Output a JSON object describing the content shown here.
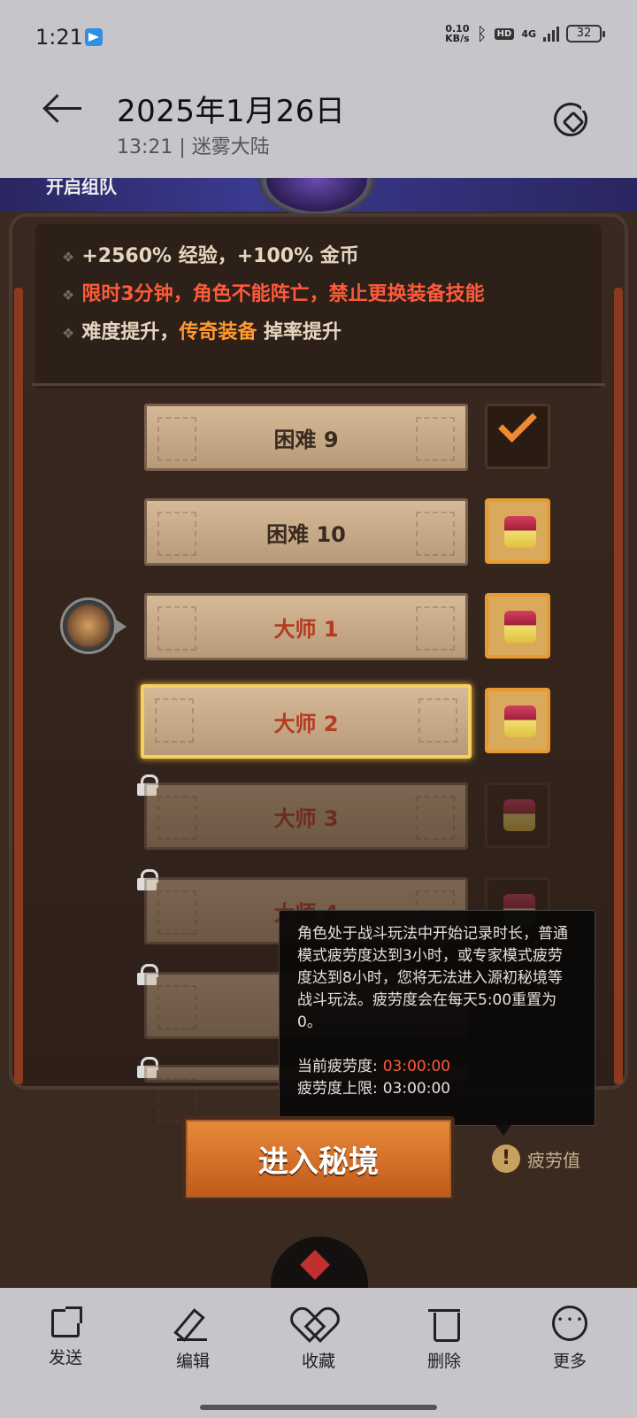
{
  "status_bar": {
    "time": "1:21",
    "speed_value": "0.10",
    "speed_unit": "KB/s",
    "hd": "HD",
    "network": "4G",
    "battery": "32"
  },
  "header": {
    "title": "2025年1月26日",
    "subtitle": "13:21 | 迷雾大陆"
  },
  "game": {
    "team_title": "开启组队",
    "info_lines": [
      {
        "text": "+2560% 经验，+100% 金币",
        "color": "#e6d6c0"
      },
      {
        "text": "限时3分钟，角色不能阵亡，禁止更换装备技能",
        "color": "#ff5a3a"
      },
      {
        "text_a": "难度提升，",
        "text_b": "传奇装备",
        "text_c": " 掉率提升",
        "color_b": "#ff9a30"
      }
    ],
    "levels": [
      {
        "label": "困难 9"
      },
      {
        "label": "困难 10"
      },
      {
        "label": "大师 1"
      },
      {
        "label": "大师 2"
      },
      {
        "label": "大师 3"
      },
      {
        "label": "大师 4"
      }
    ],
    "tooltip": {
      "body": "角色处于战斗玩法中开始记录时长，普通模式疲劳度达到3小时，或专家模式疲劳度达到8小时，您将无法进入源初秘境等战斗玩法。疲劳度会在每天5:00重置为0。",
      "current_label": "当前疲劳度:",
      "current_value": "03:00:00",
      "limit_label": "疲劳度上限:",
      "limit_value": "03:00:00"
    },
    "enter_button": "进入秘境",
    "fatigue_label": "疲劳值",
    "fatigue_icon": "!"
  },
  "toolbar": {
    "send": "发送",
    "edit": "编辑",
    "favorite": "收藏",
    "delete": "删除",
    "more": "更多"
  }
}
